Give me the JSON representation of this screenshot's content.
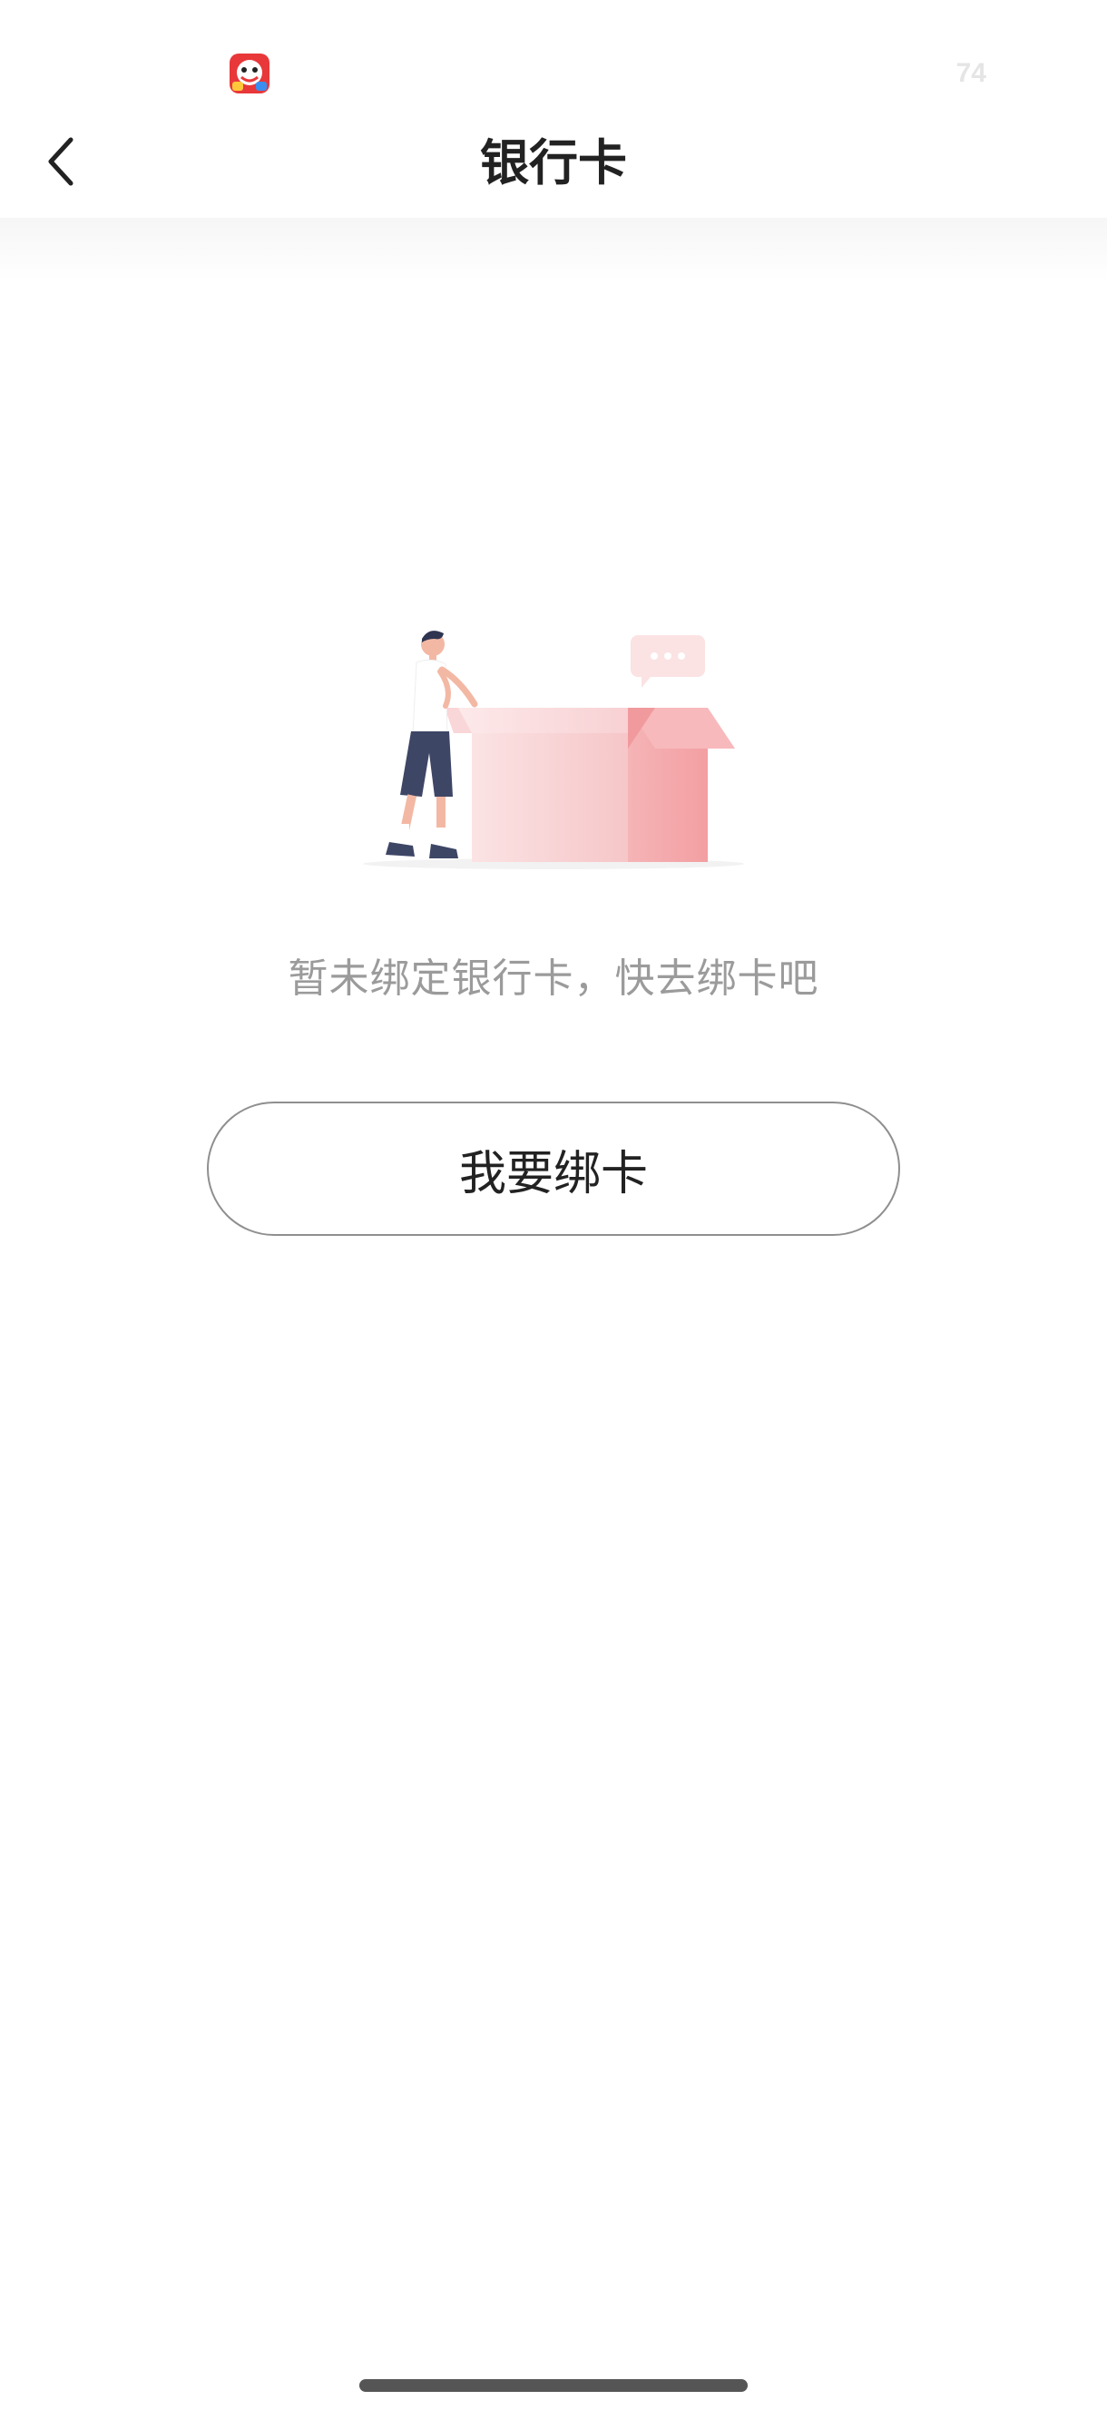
{
  "status_bar": {
    "battery": "74",
    "app_icon": "red-cartoon-app-icon"
  },
  "nav": {
    "title": "银行卡",
    "back_icon": "chevron-left-icon"
  },
  "empty_state": {
    "illustration": "person-with-empty-box-illustration",
    "message": "暂未绑定银行卡，快去绑卡吧"
  },
  "actions": {
    "bind_card_label": "我要绑卡"
  },
  "colors": {
    "accent_pink": "#f4a3a6",
    "text_primary": "#222222",
    "text_secondary": "#9b9b9b",
    "button_border": "#8f8f8f"
  }
}
